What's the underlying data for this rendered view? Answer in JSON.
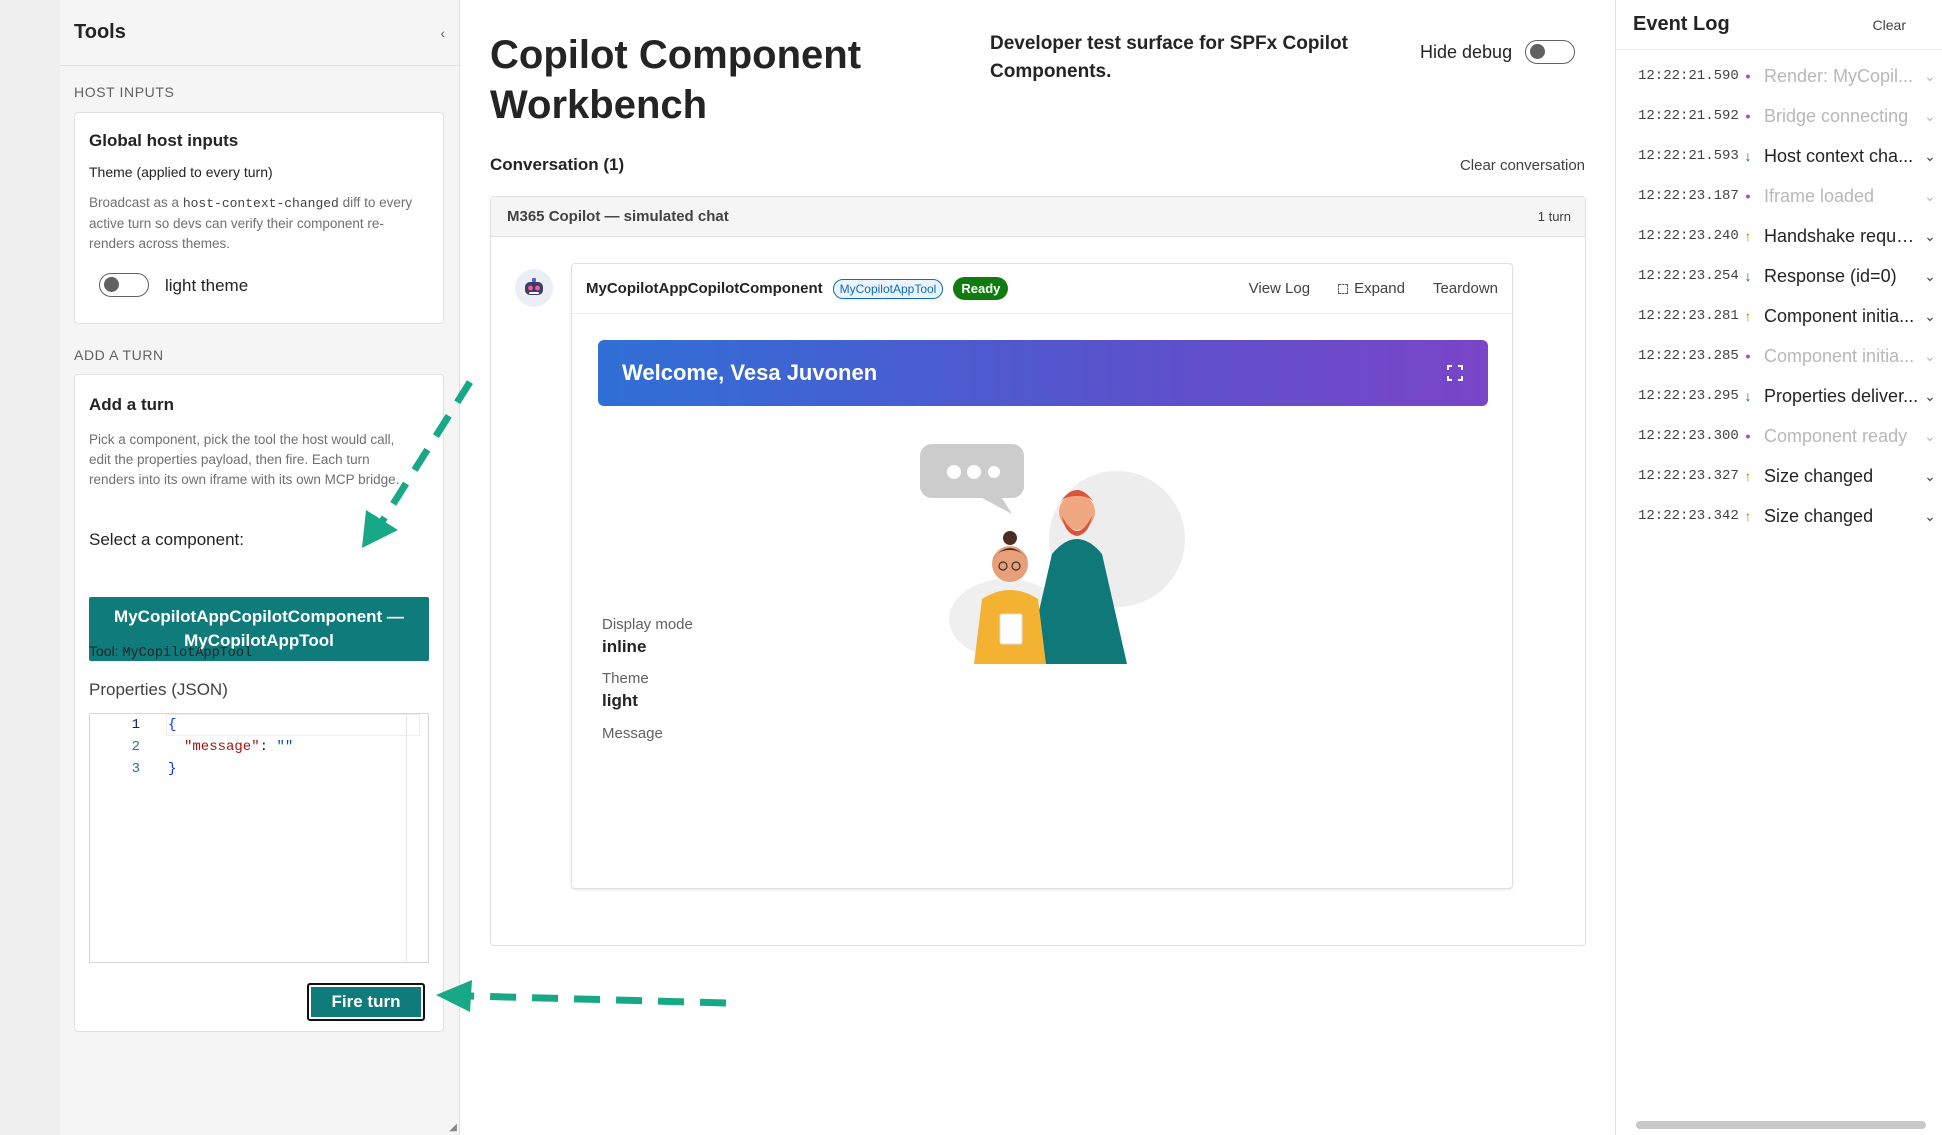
{
  "tools": {
    "title": "Tools",
    "collapse_icon": "‹",
    "host_inputs_label": "HOST INPUTS",
    "global_card": {
      "title": "Global host inputs",
      "theme_label": "Theme (applied to every turn)",
      "desc_pre": "Broadcast as a",
      "desc_code": "host-context-changed",
      "desc_post": "diff to every active turn so devs can verify their component re-renders across themes.",
      "toggle_label": "light theme"
    },
    "add_turn_label": "ADD A TURN",
    "add_card": {
      "title": "Add a turn",
      "desc": "Pick a component, pick the tool the host would call, edit the properties payload, then fire. Each turn renders into its own iframe with its own MCP bridge.",
      "select_label": "Select a component:",
      "selected_component": "MyCopilotAppCopilotComponent — MyCopilotAppTool",
      "tool_prefix": "Tool:",
      "tool_name": "MyCopilotAppTool",
      "properties_label": "Properties (JSON)",
      "fire_button": "Fire turn"
    },
    "editor": {
      "line_numbers": [
        "1",
        "2",
        "3"
      ],
      "open_brace": "{",
      "key": "\"message\"",
      "colon": ": ",
      "value": "\"\"",
      "close_brace": "}"
    }
  },
  "main": {
    "title": "Copilot Component Workbench",
    "subtitle": "Developer test surface for SPFx Copilot Components.",
    "debug_label": "Hide debug",
    "conversation_label": "Conversation (1)",
    "clear_conversation": "Clear conversation",
    "chat": {
      "title": "M365 Copilot — simulated chat",
      "turn_count": "1 turn",
      "turn": {
        "component_name": "MyCopilotAppCopilotComponent",
        "tool_badge": "MyCopilotAppTool",
        "status": "Ready",
        "actions": {
          "view_log": "View Log",
          "expand": "Expand",
          "teardown": "Teardown"
        },
        "welcome": "Welcome, Vesa Juvonen",
        "props": [
          {
            "label": "Display mode",
            "value": "inline"
          },
          {
            "label": "Theme",
            "value": "light"
          },
          {
            "label": "Message",
            "value": ""
          }
        ]
      }
    }
  },
  "event_log": {
    "title": "Event Log",
    "clear": "Clear",
    "entries": [
      {
        "time": "12:22:21.590",
        "dir": "•",
        "label": "Render: MyCopil...",
        "dim": true
      },
      {
        "time": "12:22:21.592",
        "dir": "•",
        "label": "Bridge connecting",
        "dim": true
      },
      {
        "time": "12:22:21.593",
        "dir": "↓",
        "label": "Host context cha...",
        "dim": false
      },
      {
        "time": "12:22:23.187",
        "dir": "•",
        "label": "Iframe loaded",
        "dim": true
      },
      {
        "time": "12:22:23.240",
        "dir": "↑",
        "label": "Handshake request",
        "dim": false
      },
      {
        "time": "12:22:23.254",
        "dir": "↓",
        "label": "Response (id=0)",
        "dim": false
      },
      {
        "time": "12:22:23.281",
        "dir": "↑",
        "label": "Component initia...",
        "dim": false
      },
      {
        "time": "12:22:23.285",
        "dir": "•",
        "label": "Component initia...",
        "dim": true
      },
      {
        "time": "12:22:23.295",
        "dir": "↓",
        "label": "Properties deliver...",
        "dim": false
      },
      {
        "time": "12:22:23.300",
        "dir": "•",
        "label": "Component ready",
        "dim": true
      },
      {
        "time": "12:22:23.327",
        "dir": "↑",
        "label": "Size changed",
        "dim": false
      },
      {
        "time": "12:22:23.342",
        "dir": "↑",
        "label": "Size changed",
        "dim": false
      }
    ]
  },
  "colors": {
    "accent_teal": "#0f7b7b",
    "ready_green": "#107c10",
    "dot_purple": "#b146c2",
    "arrow_down_green": "#107c10",
    "arrow_up_orange": "#d57b00",
    "annotation_arrow": "#17a886"
  }
}
